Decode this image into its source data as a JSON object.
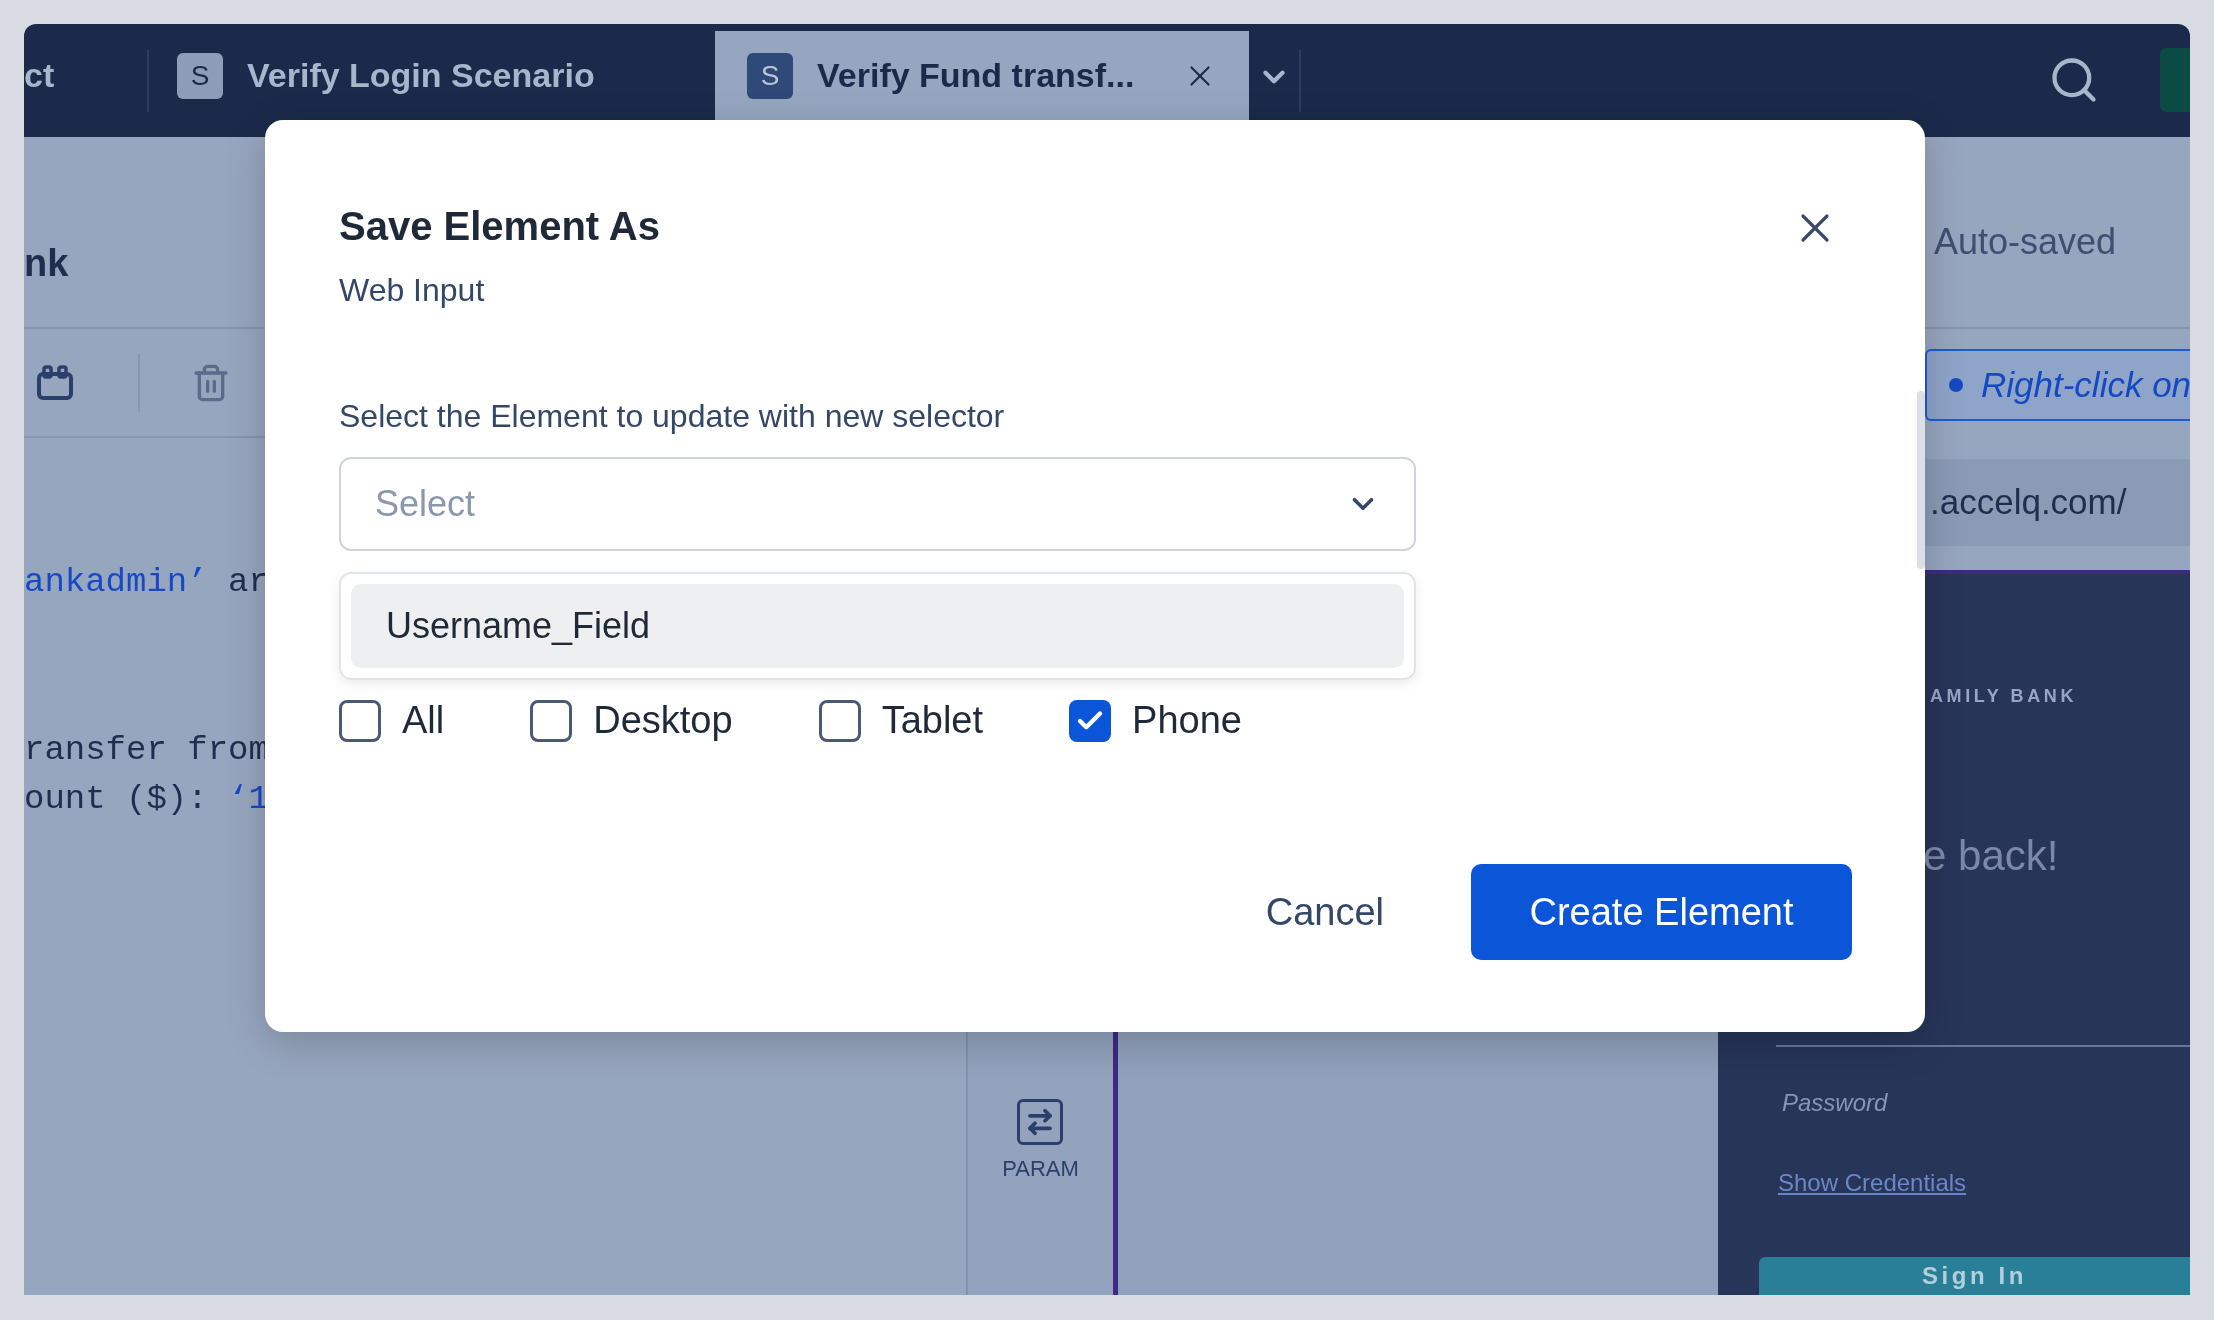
{
  "tabs": [
    {
      "label": "ct",
      "selected": false
    },
    {
      "badge": "S",
      "label": "Verify Login Scenario",
      "selected": false
    },
    {
      "badge": "S",
      "label": "Verify Fund transf...",
      "selected": true
    }
  ],
  "left_panel": {
    "title": "nk",
    "code_blocks": [
      [
        [
          {
            "kind": "string",
            "text": "ankadmin’"
          },
          {
            "kind": "plain",
            "text": " ar"
          }
        ]
      ],
      [
        [
          {
            "kind": "plain",
            "text": "ransfer from"
          }
        ],
        [
          {
            "kind": "plain",
            "text": "ount ($): "
          },
          {
            "kind": "string",
            "text": "‘1"
          }
        ]
      ]
    ]
  },
  "tool_column": {
    "items": [
      {
        "label": "PARAM"
      }
    ]
  },
  "right_panel": {
    "status": "Auto-saved",
    "hint": "Right-click on",
    "url": ".accelq.com/",
    "preview": {
      "brand": "AMILY BANK",
      "heading": "e back!",
      "password_label": "Password",
      "link": "Show Credentials",
      "button": "Sign In"
    }
  },
  "dialog": {
    "title": "Save Element As",
    "subtitle": "Web Input",
    "field_label": "Select the Element to update with new selector",
    "select": {
      "placeholder": "Select"
    },
    "options": [
      {
        "label": "Username_Field",
        "selected": true
      }
    ],
    "devices": [
      {
        "label": "All",
        "checked": false
      },
      {
        "label": "Desktop",
        "checked": false
      },
      {
        "label": "Tablet",
        "checked": false
      },
      {
        "label": "Phone",
        "checked": true
      }
    ],
    "buttons": {
      "cancel": "Cancel",
      "confirm": "Create Element"
    }
  }
}
